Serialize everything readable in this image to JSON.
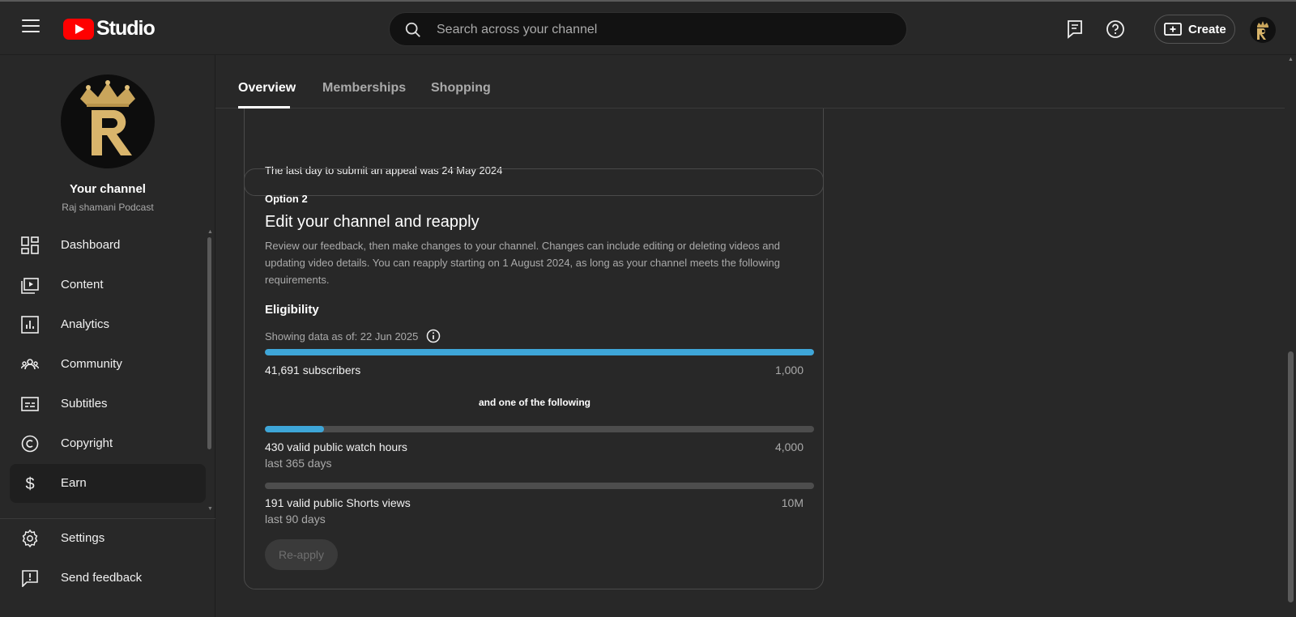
{
  "header": {
    "logo_text": "Studio",
    "search_placeholder": "Search across your channel",
    "create_label": "Create"
  },
  "sidebar": {
    "channel_title": "Your channel",
    "channel_name": "Raj shamani Podcast",
    "items": [
      {
        "label": "Dashboard",
        "icon": "dashboard-icon"
      },
      {
        "label": "Content",
        "icon": "content-icon"
      },
      {
        "label": "Analytics",
        "icon": "analytics-icon"
      },
      {
        "label": "Community",
        "icon": "community-icon"
      },
      {
        "label": "Subtitles",
        "icon": "subtitles-icon"
      },
      {
        "label": "Copyright",
        "icon": "copyright-icon"
      },
      {
        "label": "Earn",
        "icon": "earn-icon",
        "active": true
      }
    ],
    "bottom_items": [
      {
        "label": "Settings",
        "icon": "settings-icon"
      },
      {
        "label": "Send feedback",
        "icon": "feedback-icon"
      }
    ]
  },
  "tabs": [
    {
      "label": "Overview",
      "active": true
    },
    {
      "label": "Memberships"
    },
    {
      "label": "Shopping"
    }
  ],
  "option1": {
    "appeal_text": "The last day to submit an appeal was 24 May 2024"
  },
  "option2": {
    "label": "Option 2",
    "title": "Edit your channel and reapply",
    "description": "Review our feedback, then make changes to your channel. Changes can include editing or deleting videos and updating video details. You can reapply starting on 1 August 2024, as long as your channel meets the following requirements.",
    "eligibility_heading": "Eligibility",
    "showing_data": "Showing data as of: 22 Jun 2025",
    "and_one_of": "and one of the following",
    "metrics": [
      {
        "label": "41,691 subscribers",
        "target": "1,000",
        "progress": 1.0
      },
      {
        "label": "430 valid public watch hours",
        "sublabel": "last 365 days",
        "target": "4,000",
        "progress": 0.1075
      },
      {
        "label": "191 valid public Shorts views",
        "sublabel": "last 90 days",
        "target": "10M",
        "progress": 0.0
      }
    ],
    "reapply_label": "Re-apply"
  },
  "colors": {
    "background": "#282828",
    "accent_progress": "#3ea6d8",
    "brand_red": "#ff0000"
  }
}
